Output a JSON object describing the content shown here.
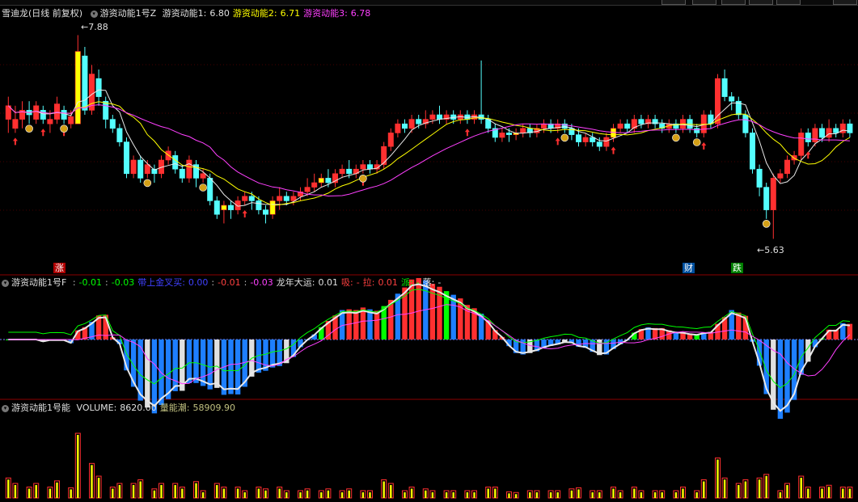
{
  "panel1": {
    "stock_label": "雪迪龙(日线 前复权)",
    "indicator_name": "游资动能1号Z",
    "fields": [
      {
        "label": "游资动能1:",
        "value": "6.80",
        "color": "#e0e0e0"
      },
      {
        "label": "游资动能2:",
        "value": "6.71",
        "color": "#ffff00"
      },
      {
        "label": "游资动能3:",
        "value": "6.78",
        "color": "#ff40ff"
      }
    ],
    "high_label": "7.88",
    "low_label": "5.63",
    "tag_zhang": "涨",
    "tag_cai": "财",
    "tag_die": "跌"
  },
  "panel2": {
    "indicator_name": "游资动能1号F",
    "items": [
      {
        "text": ":",
        "color": "#c0c0c0"
      },
      {
        "text": "-0.01",
        "color": "#00ff00"
      },
      {
        "text": ":",
        "color": "#c0c0c0"
      },
      {
        "text": "-0.03",
        "color": "#00ff00"
      },
      {
        "text": "带上金叉买:",
        "color": "#4040ff"
      },
      {
        "text": "0.00",
        "color": "#4040ff"
      },
      {
        "text": ":",
        "color": "#c0c0c0"
      },
      {
        "text": "-0.01",
        "color": "#ff4040"
      },
      {
        "text": ":",
        "color": "#c0c0c0"
      },
      {
        "text": "-0.03",
        "color": "#ff40ff"
      },
      {
        "text": "龙年大运:",
        "color": "#e0e0e0"
      },
      {
        "text": "0.01",
        "color": "#e0e0e0"
      },
      {
        "text": "吸:",
        "color": "#ff4040"
      },
      {
        "text": "-",
        "color": "#ff4040"
      },
      {
        "text": "拉:",
        "color": "#ff4040"
      },
      {
        "text": "0.01",
        "color": "#ff4040"
      },
      {
        "text": "派:",
        "color": "#00ff00"
      },
      {
        "text": "-",
        "color": "#00ff00"
      },
      {
        "text": "落:",
        "color": "#e0e0e0"
      },
      {
        "text": "-",
        "color": "#e0e0e0"
      }
    ]
  },
  "panel3": {
    "indicator_name": "游资动能1号能",
    "fields": [
      {
        "label": "VOLUME:",
        "value": "8620.00",
        "color": "#e0e0e0"
      },
      {
        "label": "量能潮:",
        "value": "58909.90",
        "color": "#c0c080"
      }
    ]
  },
  "colors": {
    "up": "#ff3030",
    "down": "#54ffff",
    "yellow": "#ffff00",
    "white": "#e8e8e8",
    "magenta": "#ff40ff",
    "green": "#00ff00",
    "blue": "#1e7fff",
    "grid": "#8b0000"
  },
  "chart_data": {
    "type": "candlestick",
    "y_range": [
      5.5,
      8.0
    ],
    "candles": [
      [
        6.95,
        7.1,
        6.8,
        7.2
      ],
      [
        6.85,
        6.95,
        6.8,
        7.1
      ],
      [
        6.95,
        7.05,
        6.85,
        7.15
      ],
      [
        7.05,
        7.0,
        6.9,
        7.15
      ],
      [
        6.95,
        7.1,
        6.9,
        7.15
      ],
      [
        7.05,
        6.95,
        6.9,
        7.1
      ],
      [
        6.9,
        6.95,
        6.8,
        7.05
      ],
      [
        6.95,
        7.12,
        6.9,
        7.2
      ],
      [
        7.05,
        6.95,
        6.9,
        7.1
      ],
      [
        6.9,
        6.98,
        6.85,
        7.05
      ],
      [
        6.9,
        7.7,
        6.9,
        7.88
      ],
      [
        7.65,
        7.05,
        7.0,
        7.75
      ],
      [
        7.05,
        7.45,
        7.0,
        7.55
      ],
      [
        7.4,
        7.2,
        7.1,
        7.5
      ],
      [
        7.15,
        6.95,
        6.85,
        7.2
      ],
      [
        6.95,
        6.85,
        6.8,
        7.0
      ],
      [
        6.85,
        6.7,
        6.65,
        6.9
      ],
      [
        6.7,
        6.35,
        6.3,
        6.75
      ],
      [
        6.35,
        6.5,
        6.3,
        6.55
      ],
      [
        6.5,
        6.3,
        6.25,
        6.55
      ],
      [
        6.35,
        6.45,
        6.3,
        6.5
      ],
      [
        6.4,
        6.35,
        6.25,
        6.45
      ],
      [
        6.35,
        6.5,
        6.3,
        6.55
      ],
      [
        6.5,
        6.6,
        6.45,
        6.65
      ],
      [
        6.55,
        6.4,
        6.35,
        6.6
      ],
      [
        6.4,
        6.3,
        6.25,
        6.45
      ],
      [
        6.3,
        6.5,
        6.25,
        6.55
      ],
      [
        6.45,
        6.3,
        6.2,
        6.5
      ],
      [
        6.3,
        6.35,
        6.25,
        6.4
      ],
      [
        6.3,
        6.05,
        6.0,
        6.35
      ],
      [
        6.05,
        5.9,
        5.85,
        6.1
      ],
      [
        5.95,
        6.0,
        5.8,
        6.05
      ],
      [
        6.0,
        5.95,
        5.85,
        6.05
      ],
      [
        5.95,
        6.05,
        5.9,
        6.1
      ],
      [
        6.05,
        6.1,
        6.0,
        6.15
      ],
      [
        6.1,
        6.05,
        5.95,
        6.15
      ],
      [
        6.05,
        5.95,
        5.9,
        6.1
      ],
      [
        5.95,
        5.9,
        5.8,
        6.0
      ],
      [
        5.9,
        6.05,
        5.85,
        6.1
      ],
      [
        6.05,
        6.1,
        5.95,
        6.2
      ],
      [
        6.1,
        6.05,
        6.0,
        6.15
      ],
      [
        6.05,
        6.1,
        6.0,
        6.15
      ],
      [
        6.1,
        6.15,
        6.05,
        6.2
      ],
      [
        6.15,
        6.2,
        6.1,
        6.3
      ],
      [
        6.2,
        6.25,
        6.15,
        6.35
      ],
      [
        6.25,
        6.3,
        6.2,
        6.35
      ],
      [
        6.3,
        6.25,
        6.2,
        6.4
      ],
      [
        6.25,
        6.35,
        6.2,
        6.4
      ],
      [
        6.35,
        6.4,
        6.3,
        6.45
      ],
      [
        6.4,
        6.35,
        6.3,
        6.5
      ],
      [
        6.35,
        6.4,
        6.3,
        6.45
      ],
      [
        6.4,
        6.45,
        6.35,
        6.5
      ],
      [
        6.45,
        6.4,
        6.35,
        6.5
      ],
      [
        6.4,
        6.45,
        6.35,
        6.5
      ],
      [
        6.45,
        6.65,
        6.4,
        6.7
      ],
      [
        6.65,
        6.8,
        6.6,
        6.85
      ],
      [
        6.8,
        6.9,
        6.75,
        6.95
      ],
      [
        6.9,
        6.85,
        6.8,
        6.95
      ],
      [
        6.85,
        6.95,
        6.8,
        7.0
      ],
      [
        6.95,
        6.9,
        6.85,
        7.0
      ],
      [
        6.9,
        6.95,
        6.85,
        7.05
      ],
      [
        6.95,
        7.0,
        6.9,
        7.05
      ],
      [
        7.0,
        6.95,
        6.9,
        7.1
      ],
      [
        6.95,
        7.0,
        6.9,
        7.05
      ],
      [
        7.0,
        6.95,
        6.9,
        7.05
      ],
      [
        6.95,
        7.0,
        6.9,
        7.05
      ],
      [
        7.0,
        6.95,
        6.9,
        7.05
      ],
      [
        6.95,
        7.0,
        6.9,
        7.05
      ],
      [
        7.0,
        6.95,
        6.9,
        7.6
      ],
      [
        6.95,
        6.85,
        6.8,
        7.0
      ],
      [
        6.85,
        6.75,
        6.7,
        6.9
      ],
      [
        6.75,
        6.8,
        6.7,
        6.85
      ],
      [
        6.8,
        6.78,
        6.7,
        6.85
      ],
      [
        6.78,
        6.8,
        6.72,
        6.85
      ],
      [
        6.8,
        6.85,
        6.75,
        6.9
      ],
      [
        6.85,
        6.8,
        6.75,
        6.9
      ],
      [
        6.8,
        6.85,
        6.75,
        6.9
      ],
      [
        6.85,
        6.9,
        6.8,
        6.95
      ],
      [
        6.9,
        6.85,
        6.8,
        6.95
      ],
      [
        6.85,
        6.9,
        6.8,
        6.95
      ],
      [
        6.9,
        6.85,
        6.8,
        6.95
      ],
      [
        6.85,
        6.78,
        6.72,
        6.9
      ],
      [
        6.78,
        6.7,
        6.65,
        6.85
      ],
      [
        6.7,
        6.75,
        6.65,
        6.8
      ],
      [
        6.75,
        6.7,
        6.65,
        6.8
      ],
      [
        6.7,
        6.65,
        6.6,
        6.75
      ],
      [
        6.65,
        6.75,
        6.6,
        6.8
      ],
      [
        6.75,
        6.85,
        6.7,
        6.9
      ],
      [
        6.85,
        6.9,
        6.8,
        6.95
      ],
      [
        6.9,
        6.85,
        6.8,
        6.95
      ],
      [
        6.85,
        6.95,
        6.8,
        7.0
      ],
      [
        6.95,
        6.9,
        6.85,
        7.0
      ],
      [
        6.9,
        6.95,
        6.85,
        7.0
      ],
      [
        6.95,
        6.9,
        6.85,
        7.0
      ],
      [
        6.9,
        6.85,
        6.8,
        6.95
      ],
      [
        6.85,
        6.9,
        6.8,
        6.95
      ],
      [
        6.9,
        6.85,
        6.8,
        6.95
      ],
      [
        6.85,
        6.95,
        6.8,
        7.0
      ],
      [
        6.95,
        6.85,
        6.8,
        7.0
      ],
      [
        6.85,
        6.8,
        6.75,
        6.9
      ],
      [
        6.8,
        7.0,
        6.75,
        7.05
      ],
      [
        7.0,
        6.9,
        6.85,
        7.05
      ],
      [
        6.9,
        7.4,
        6.85,
        7.45
      ],
      [
        7.4,
        7.2,
        7.15,
        7.5
      ],
      [
        7.2,
        7.15,
        7.05,
        7.25
      ],
      [
        7.15,
        7.0,
        6.95,
        7.2
      ],
      [
        7.0,
        6.8,
        6.75,
        7.05
      ],
      [
        6.8,
        6.4,
        6.35,
        6.85
      ],
      [
        6.4,
        6.2,
        6.1,
        6.45
      ],
      [
        6.2,
        5.95,
        5.85,
        6.25
      ],
      [
        5.95,
        6.3,
        5.63,
        6.35
      ],
      [
        6.3,
        6.35,
        6.25,
        6.4
      ],
      [
        6.35,
        6.5,
        6.3,
        6.55
      ],
      [
        6.5,
        6.55,
        6.45,
        6.6
      ],
      [
        6.55,
        6.8,
        6.5,
        6.85
      ],
      [
        6.8,
        6.7,
        6.65,
        6.85
      ],
      [
        6.7,
        6.85,
        6.65,
        6.9
      ],
      [
        6.85,
        6.75,
        6.7,
        6.9
      ],
      [
        6.75,
        6.85,
        6.7,
        6.95
      ],
      [
        6.85,
        6.8,
        6.75,
        6.9
      ],
      [
        6.8,
        6.9,
        6.75,
        6.95
      ],
      [
        6.9,
        6.8,
        6.75,
        6.95
      ]
    ]
  }
}
